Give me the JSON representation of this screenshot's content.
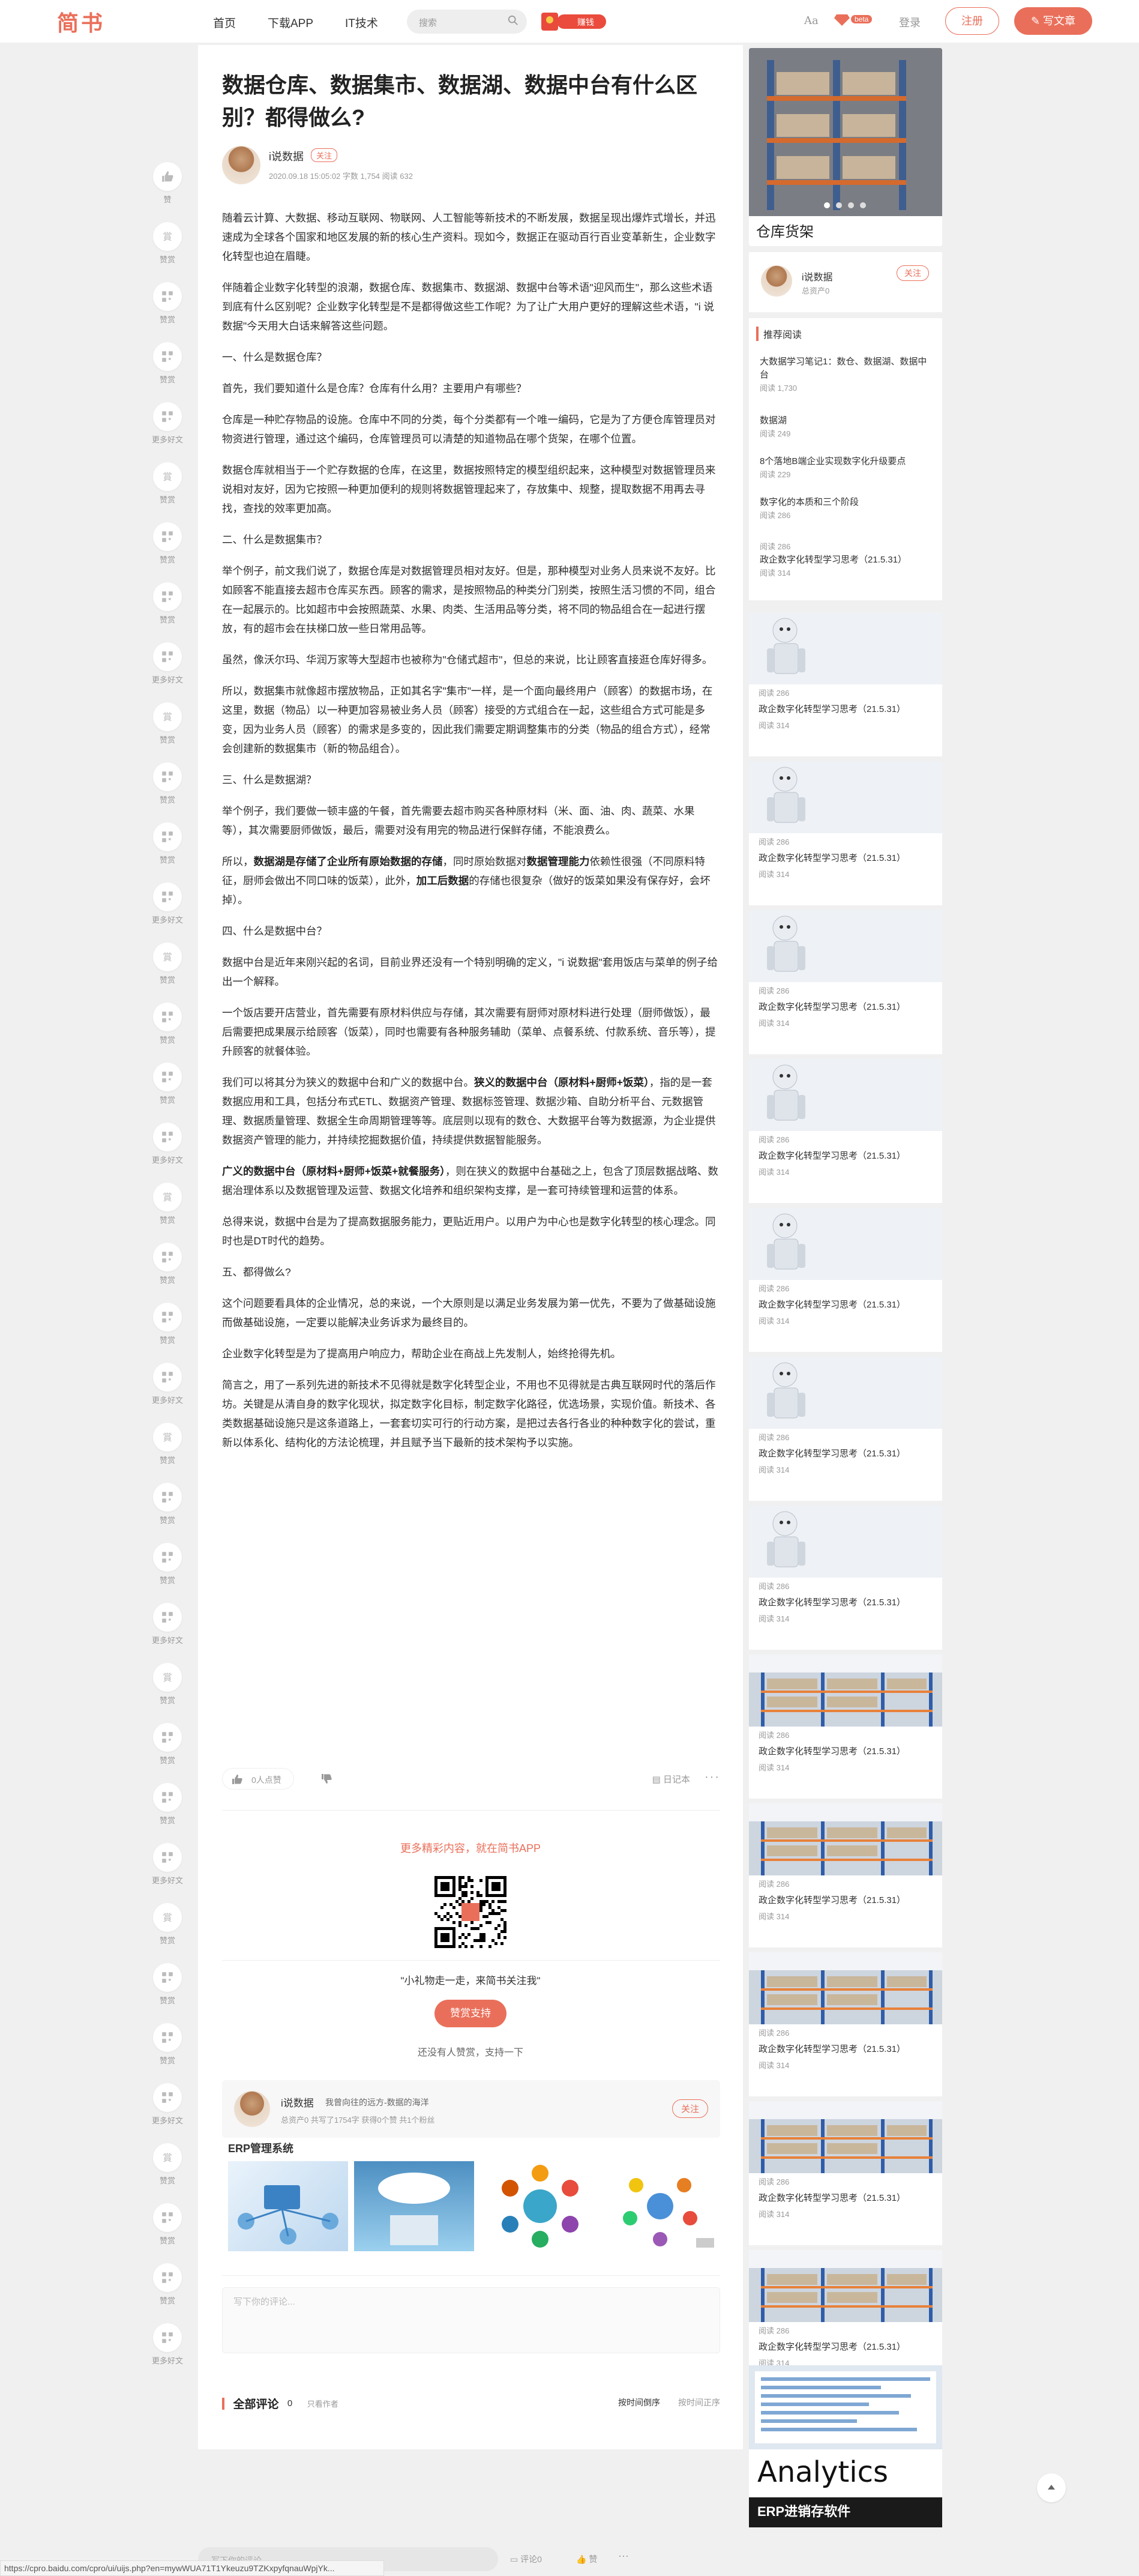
{
  "nav": {
    "logo": "简书",
    "links": [
      "首页",
      "下载APP",
      "IT技术"
    ],
    "search_placeholder": "搜索",
    "promo_badge": "赚钱",
    "aa": "Aa",
    "beta": "beta",
    "login": "登录",
    "register": "注册",
    "write": "写文章"
  },
  "rail": {
    "like_label": "赞",
    "reward_label": "赞赏",
    "more_label": "更多好文"
  },
  "article": {
    "title": "数据仓库、数据集市、数据湖、数据中台有什么区别？都得做么?",
    "author": "i说数据",
    "follow": "关注",
    "meta": "2020.09.18 15:05:02   字数 1,754   阅读 632",
    "paragraphs": [
      "随着云计算、大数据、移动互联网、物联网、人工智能等新技术的不断发展，数据呈现出爆炸式增长，并迅速成为全球各个国家和地区发展的新的核心生产资料。现如今，数据正在驱动百行百业变革新生，企业数字化转型也迫在眉睫。",
      "伴随着企业数字化转型的浪潮，数据仓库、数据集市、数据湖、数据中台等术语\"迎风而生\"，那么这些术语到底有什么区别呢？企业数字化转型是不是都得做这些工作呢？为了让广大用户更好的理解这些术语，\"i 说数据\"今天用大白话来解答这些问题。",
      "一、什么是数据仓库？",
      "首先，我们要知道什么是仓库？仓库有什么用？主要用户有哪些？",
      "仓库是一种贮存物品的设施。仓库中不同的分类，每个分类都有一个唯一编码，它是为了方便仓库管理员对物资进行管理，通过这个编码，仓库管理员可以清楚的知道物品在哪个货架，在哪个位置。",
      "数据仓库就相当于一个贮存数据的仓库，在这里，数据按照特定的模型组织起来，这种模型对数据管理员来说相对友好，因为它按照一种更加便利的规则将数据管理起来了，存放集中、规整，提取数据不用再去寻找，查找的效率更加高。",
      "二、什么是数据集市？",
      "举个例子，前文我们说了，数据仓库是对数据管理员相对友好。但是，那种模型对业务人员来说不友好。比如顾客不能直接去超市仓库买东西。顾客的需求，是按照物品的种类分门别类，按照生活习惯的不同，组合在一起展示的。比如超市中会按照蔬菜、水果、肉类、生活用品等分类，将不同的物品组合在一起进行摆放，有的超市会在扶梯口放一些日常用品等。",
      "虽然，像沃尔玛、华润万家等大型超市也被称为\"仓储式超市\"，但总的来说，比让顾客直接逛仓库好得多。",
      "所以，数据集市就像超市摆放物品，正如其名字\"集市\"一样，是一个面向最终用户（顾客）的数据市场，在这里，数据（物品）以一种更加容易被业务人员（顾客）接受的方式组合在一起，这些组合方式可能是多变，因为业务人员（顾客）的需求是多变的，因此我们需要定期调整集市的分类（物品的组合方式），经常会创建新的数据集市（新的物品组合）。",
      "三、什么是数据湖？",
      "举个例子，我们要做一顿丰盛的午餐，首先需要去超市购买各种原材料（米、面、油、肉、蔬菜、水果等），其次需要厨师做饭，最后，需要对没有用完的物品进行保鲜存储，不能浪费么。",
      "四、什么是数据中台？",
      "数据中台是近年来刚兴起的名词，目前业界还没有一个特别明确的定义，\"i 说数据\"套用饭店与菜单的例子给出一个解释。",
      "一个饭店要开店营业，首先需要有原材料供应与存储，其次需要有厨师对原材料进行处理（厨师做饭），最后需要把成果展示给顾客（饭菜），同时也需要有各种服务辅助（菜单、点餐系统、付款系统、音乐等），提升顾客的就餐体验。",
      "总得来说，数据中台是为了提高数据服务能力，更贴近用户。以用户为中心也是数字化转型的核心理念。同时也是DT时代的趋势。",
      "五、都得做么?",
      "这个问题要看具体的企业情况，总的来说，一个大原则是以满足业务发展为第一优先，不要为了做基础设施而做基础设施，一定要以能解决业务诉求为最终目的。",
      "企业数字化转型是为了提高用户响应力，帮助企业在商战上先发制人，始终抢得先机。",
      "简言之，用了一系列先进的新技术不见得就是数字化转型企业，不用也不见得就是古典互联网时代的落后作坊。关键是从清自身的数字化现状，拟定数字化目标，制定数字化路径，优选场景，实现价值。新技术、各类数据基础设施只是这条道路上，一套套切实可行的行动方案，是把过去各行各业的种种数字化的尝试，重新以体系化、结构化的方法论梳理，并且赋予当下最新的技术架构予以实施。"
    ],
    "p_lake_a": "所以，",
    "p_lake_b1": "数据湖是存储了企业所有原始数据的存储",
    "p_lake_c": "，同时原始数据对",
    "p_lake_b2": "数据管理能力",
    "p_lake_d": "依赖性很强（不同原料特征，厨师会做出不同口味的饭菜），此外，",
    "p_lake_b3": "加工后数据",
    "p_lake_e": "的存储也很复杂（做好的饭菜如果没有保存好，会坏掉）。",
    "p_mid_a": "我们可以将其分为狭义的数据中台和广义的数据中台。",
    "p_mid_b": "狭义的数据中台（原材料+厨师+饭菜）",
    "p_mid_c": "，指的是一套数据应用和工具，包括分布式ETL、数据资产管理、数据标签管理、数据沙箱、自助分析平台、元数据管理、数据质量管理、数据全生命周期管理等等。底层则以现有的数仓、大数据平台等为数据源，为企业提供数据资产管理的能力，并持续挖掘数据价值，持续提供数据智能服务。",
    "p_wide_b": "广义的数据中台（原材料+厨师+饭菜+就餐服务）",
    "p_wide_c": "，则在狭义的数据中台基础之上，包含了顶层数据战略、数据治理体系以及数据管理及运营、数据文化培养和组织架构支撑，是一套可持续管理和运营的体系。",
    "like_count": "0人点赞",
    "diary": "日记本",
    "more": "···"
  },
  "bottom": {
    "app_promo": "更多精彩内容，就在简书APP",
    "reward_question": "\"小礼物走一走，来简书关注我\"",
    "reward_button": "赞赏支持",
    "reward_none": "还没有人赞赏，支持一下",
    "author_name": "i说数据",
    "author_bio": "我曾向往的远方-数据的海洋",
    "author_stats": "总资产0   共写了1754字   获得0个赞   共1个粉丝",
    "author_follow": "关注",
    "ad_title": "ERP管理系统",
    "comment_placeholder": "写下你的评论...",
    "comments_title": "全部评论",
    "comments_count": "0",
    "only_author": "只看作者",
    "sort_time": "按时间倒序",
    "sort_time_asc": "按时间正序"
  },
  "sidebar": {
    "hero_caption": "仓库货架",
    "author_name": "i说数据",
    "author_asset": "总资产0",
    "author_follow": "关注",
    "rec_title": "推荐阅读",
    "rec_items": [
      {
        "title": "大数据学习笔记1：数仓、数据湖、数据中台",
        "reads": "阅读 1,730"
      },
      {
        "title": "数据湖",
        "reads": "阅读 249"
      },
      {
        "title": "8个落地B端企业实现数字化升级要点",
        "reads": "阅读 229"
      },
      {
        "title": "数字化的本质和三个阶段",
        "reads": "阅读 286"
      },
      {
        "title": "",
        "reads": "阅读 286"
      }
    ],
    "card_title": "政企数字化转型学习思考（21.5.31）",
    "card_read_top": "阅读 286",
    "card_read_bottom": "阅读 314",
    "analytics_text": "Analytics",
    "analytics_label": "ERP进销存软件"
  },
  "footer": {
    "comment_placeholder": "写下你的评论...",
    "comment": "评论0",
    "like": "赞",
    "more": "···",
    "status_url": "https://cpro.baidu.com/cpro/ui/uijs.php?en=mywWUA71T1Ykeuzu9TZKxpyfqnauWpjYk..."
  },
  "colors": {
    "accent": "#ea6f5a",
    "bg": "#f0f0f0"
  }
}
